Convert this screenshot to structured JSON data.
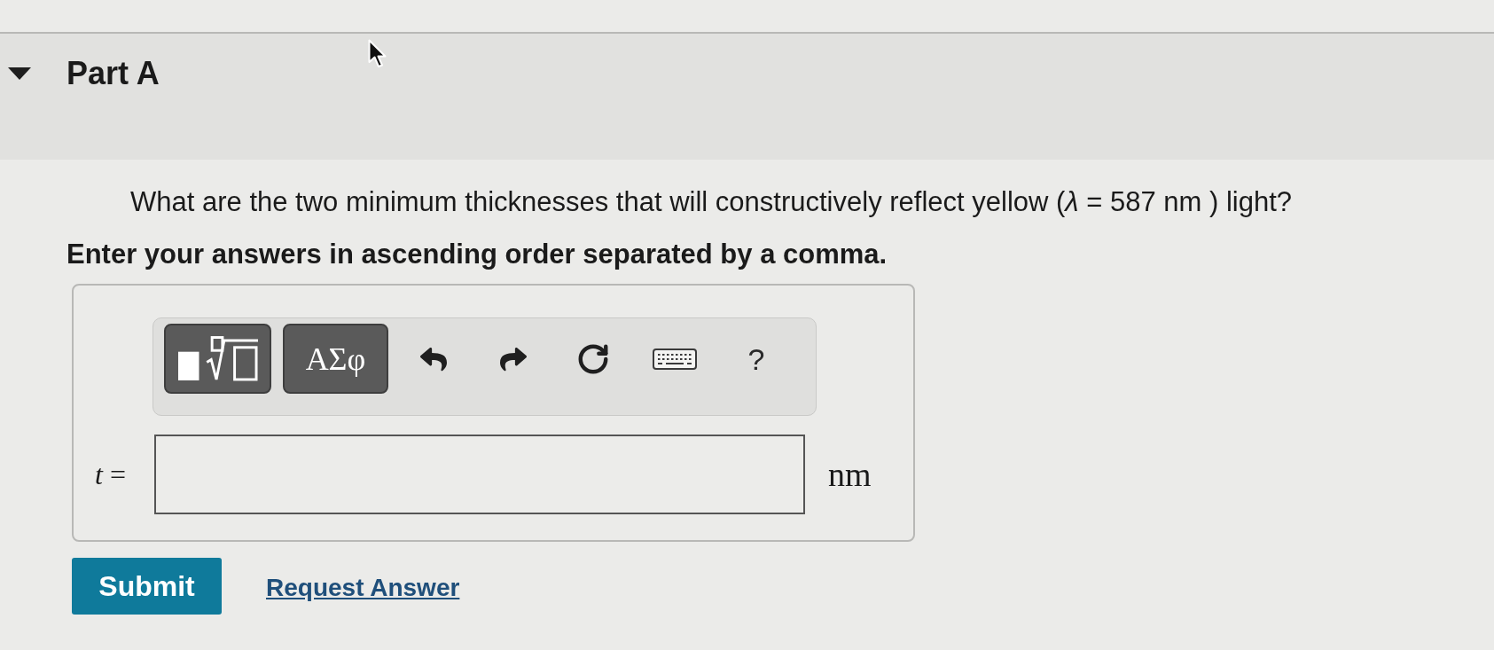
{
  "section": {
    "title": "Part A",
    "expanded": true
  },
  "question": {
    "text": "What are the two minimum thicknesses that will constructively reflect yellow (*λ* = 587 nm ) light?"
  },
  "instruction": {
    "text": "Enter your answers in ascending order separated by a comma."
  },
  "answer_panel": {
    "toolbar": [
      {
        "kind": "templates"
      },
      {
        "kind": "symbols",
        "label": "ΑΣφ"
      },
      {
        "kind": "undo"
      },
      {
        "kind": "redo"
      },
      {
        "kind": "reset"
      },
      {
        "kind": "keyboard"
      },
      {
        "kind": "help",
        "label": "?"
      }
    ],
    "field": {
      "label": "*t* =",
      "unit": "nm"
    }
  },
  "actions": [
    {
      "kind": "primary",
      "label": "Submit"
    },
    {
      "kind": "link",
      "label": "Request Answer"
    }
  ]
}
